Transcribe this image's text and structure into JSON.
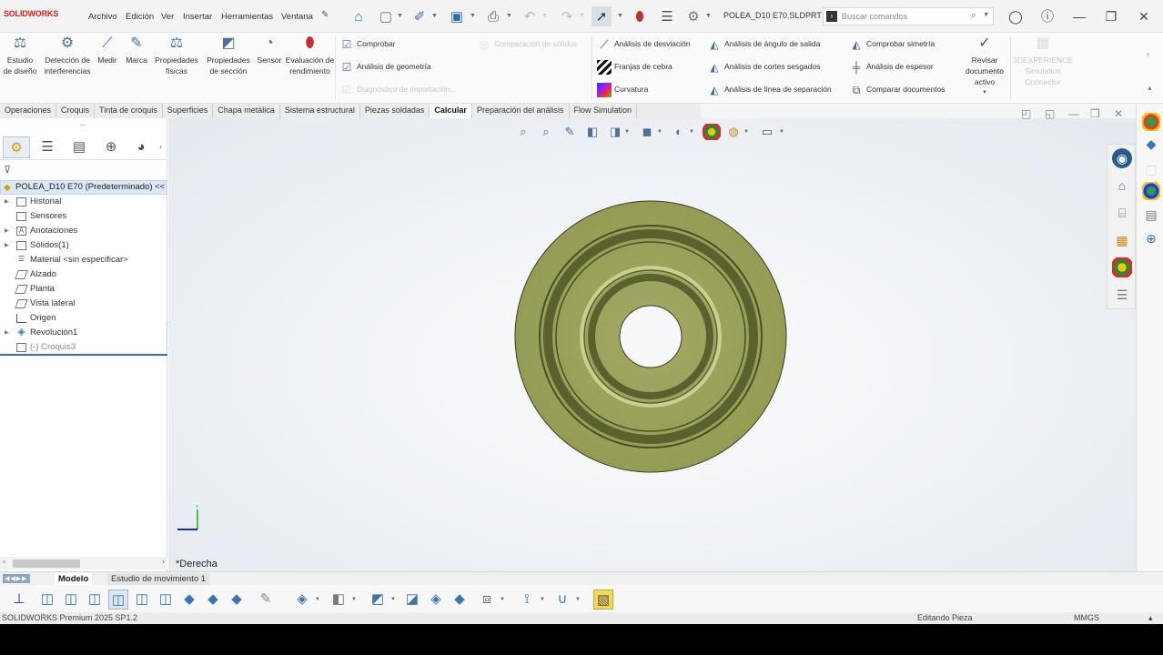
{
  "titlebar": {
    "brand": "SOLIDWORKS",
    "menus": [
      "Archivo",
      "Edición",
      "Ver",
      "Insertar",
      "Herramientas",
      "Ventana"
    ],
    "doc_title": "POLEA_D10 E70.SLDPRT",
    "search_placeholder": "Buscar comandos"
  },
  "ribbon": {
    "big_buttons": [
      {
        "label": "Estudio de diseño",
        "icon": "design-study-icon"
      },
      {
        "label": "Detección de interferencias",
        "icon": "interference-icon"
      },
      {
        "label": "Medir",
        "icon": "measure-icon"
      },
      {
        "label": "Marca",
        "icon": "markup-icon"
      },
      {
        "label": "Propiedades físicas",
        "icon": "mass-properties-icon"
      },
      {
        "label": "Propiedades de sección",
        "icon": "section-properties-icon"
      },
      {
        "label": "Sensor",
        "icon": "sensor-icon"
      },
      {
        "label": "Evaluación de rendimiento",
        "icon": "performance-icon"
      }
    ],
    "col1": [
      {
        "label": "Comprobar",
        "enabled": true
      },
      {
        "label": "Análisis de geometría",
        "enabled": true
      },
      {
        "label": "Diagnóstico de importación...",
        "enabled": false
      }
    ],
    "compare_solids": "Comparación de sólidos",
    "col2": [
      "Análisis de desviación",
      "Franjas de cebra",
      "Curvatura"
    ],
    "col3": [
      "Análisis de ángulo de salida",
      "Análisis de cortes sesgados",
      "Análisis de línea de separación"
    ],
    "col4": [
      "Comprobar simetría",
      "Análisis de espesor",
      "Comparar documentos"
    ],
    "review": "Revisar documento activo",
    "experience": "3DEXPERIENCE Simulation Connector"
  },
  "command_tabs": [
    "Operaciones",
    "Croquis",
    "Tinta de croquis",
    "Superficies",
    "Chapa metálica",
    "Sistema estructural",
    "Piezas soldadas",
    "Calcular",
    "Preparación del análisis",
    "Flow Simulation"
  ],
  "active_command_tab": "Calcular",
  "feature_tree": {
    "root": "POLEA_D10 E70 (Predeterminado) <<",
    "nodes": [
      {
        "label": "Historial",
        "expandable": true
      },
      {
        "label": "Sensores",
        "expandable": false
      },
      {
        "label": "Anotaciones",
        "expandable": true
      },
      {
        "label": "Sólidos(1)",
        "expandable": true
      },
      {
        "label": "Material <sin especificar>",
        "expandable": false
      },
      {
        "label": "Alzado",
        "expandable": false
      },
      {
        "label": "Planta",
        "expandable": false
      },
      {
        "label": "Vista lateral",
        "expandable": false
      },
      {
        "label": "Origen",
        "expandable": false
      },
      {
        "label": "Revolución1",
        "expandable": true
      },
      {
        "label": "(-) Croquis3",
        "expandable": false
      }
    ]
  },
  "viewport": {
    "view_label": "*Derecha",
    "part_color": "#9ba25a"
  },
  "bottom_tabs": [
    "Modelo",
    "Estudio de movimiento 1"
  ],
  "active_bottom_tab": "Modelo",
  "status": {
    "product": "SOLIDWORKS Premium 2025 SP1.2",
    "mode": "Editando Pieza",
    "units": "MMGS"
  }
}
